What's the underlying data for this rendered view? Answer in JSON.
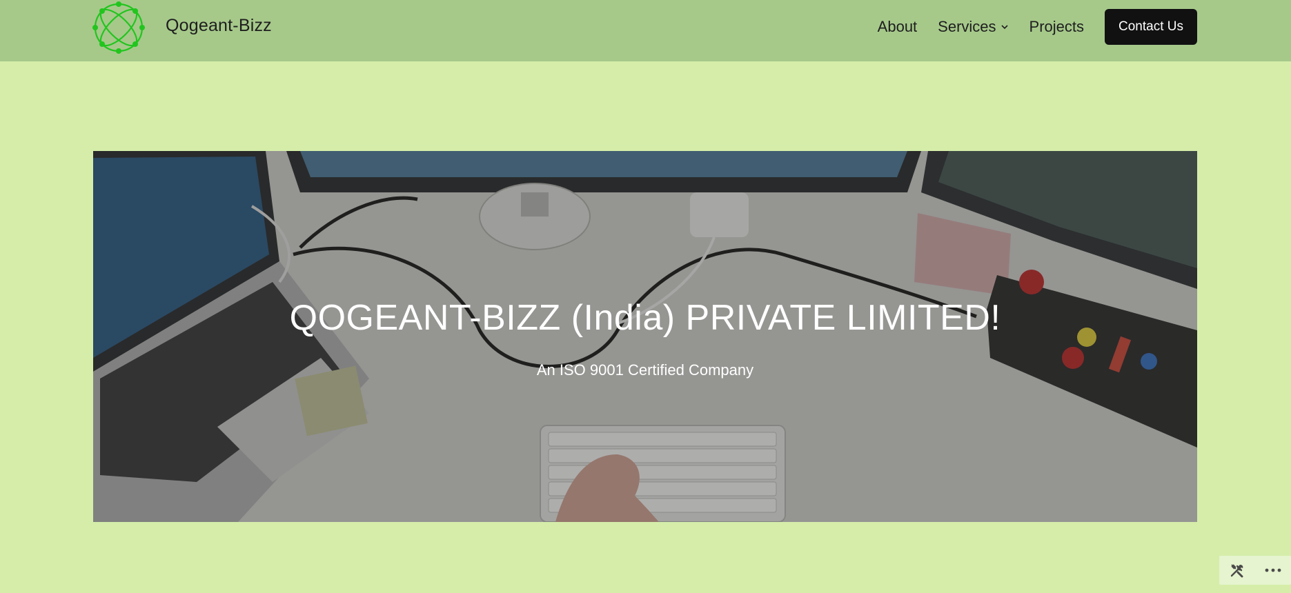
{
  "header": {
    "site_title": "Qogeant-Bizz",
    "logo_icon": "network-globe-icon",
    "nav": {
      "about": "About",
      "services": "Services",
      "projects": "Projects",
      "contact": "Contact Us"
    }
  },
  "hero": {
    "title": "QOGEANT-BIZZ (India) PRIVATE LIMITED!",
    "subtitle": "An ISO 9001 Certified Company"
  },
  "toolbar": {
    "tools_icon": "tools-icon",
    "more_icon": "more-dots-icon"
  },
  "colors": {
    "page_background": "#d5eda9",
    "header_background": "#a6c98a",
    "button_background": "#111111",
    "logo_green": "#22c51e"
  }
}
